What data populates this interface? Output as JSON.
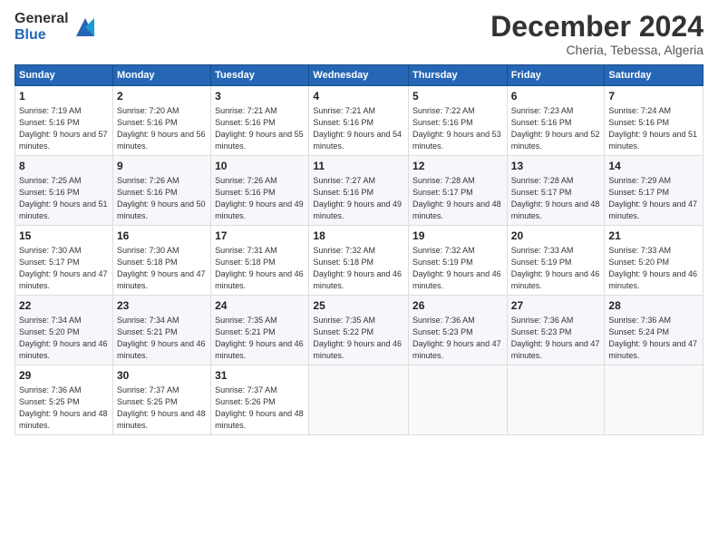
{
  "logo": {
    "general": "General",
    "blue": "Blue"
  },
  "header": {
    "month": "December 2024",
    "location": "Cheria, Tebessa, Algeria"
  },
  "weekdays": [
    "Sunday",
    "Monday",
    "Tuesday",
    "Wednesday",
    "Thursday",
    "Friday",
    "Saturday"
  ],
  "weeks": [
    [
      {
        "day": "1",
        "sunrise": "7:19 AM",
        "sunset": "5:16 PM",
        "daylight": "9 hours and 57 minutes."
      },
      {
        "day": "2",
        "sunrise": "7:20 AM",
        "sunset": "5:16 PM",
        "daylight": "9 hours and 56 minutes."
      },
      {
        "day": "3",
        "sunrise": "7:21 AM",
        "sunset": "5:16 PM",
        "daylight": "9 hours and 55 minutes."
      },
      {
        "day": "4",
        "sunrise": "7:21 AM",
        "sunset": "5:16 PM",
        "daylight": "9 hours and 54 minutes."
      },
      {
        "day": "5",
        "sunrise": "7:22 AM",
        "sunset": "5:16 PM",
        "daylight": "9 hours and 53 minutes."
      },
      {
        "day": "6",
        "sunrise": "7:23 AM",
        "sunset": "5:16 PM",
        "daylight": "9 hours and 52 minutes."
      },
      {
        "day": "7",
        "sunrise": "7:24 AM",
        "sunset": "5:16 PM",
        "daylight": "9 hours and 51 minutes."
      }
    ],
    [
      {
        "day": "8",
        "sunrise": "7:25 AM",
        "sunset": "5:16 PM",
        "daylight": "9 hours and 51 minutes."
      },
      {
        "day": "9",
        "sunrise": "7:26 AM",
        "sunset": "5:16 PM",
        "daylight": "9 hours and 50 minutes."
      },
      {
        "day": "10",
        "sunrise": "7:26 AM",
        "sunset": "5:16 PM",
        "daylight": "9 hours and 49 minutes."
      },
      {
        "day": "11",
        "sunrise": "7:27 AM",
        "sunset": "5:16 PM",
        "daylight": "9 hours and 49 minutes."
      },
      {
        "day": "12",
        "sunrise": "7:28 AM",
        "sunset": "5:17 PM",
        "daylight": "9 hours and 48 minutes."
      },
      {
        "day": "13",
        "sunrise": "7:28 AM",
        "sunset": "5:17 PM",
        "daylight": "9 hours and 48 minutes."
      },
      {
        "day": "14",
        "sunrise": "7:29 AM",
        "sunset": "5:17 PM",
        "daylight": "9 hours and 47 minutes."
      }
    ],
    [
      {
        "day": "15",
        "sunrise": "7:30 AM",
        "sunset": "5:17 PM",
        "daylight": "9 hours and 47 minutes."
      },
      {
        "day": "16",
        "sunrise": "7:30 AM",
        "sunset": "5:18 PM",
        "daylight": "9 hours and 47 minutes."
      },
      {
        "day": "17",
        "sunrise": "7:31 AM",
        "sunset": "5:18 PM",
        "daylight": "9 hours and 46 minutes."
      },
      {
        "day": "18",
        "sunrise": "7:32 AM",
        "sunset": "5:18 PM",
        "daylight": "9 hours and 46 minutes."
      },
      {
        "day": "19",
        "sunrise": "7:32 AM",
        "sunset": "5:19 PM",
        "daylight": "9 hours and 46 minutes."
      },
      {
        "day": "20",
        "sunrise": "7:33 AM",
        "sunset": "5:19 PM",
        "daylight": "9 hours and 46 minutes."
      },
      {
        "day": "21",
        "sunrise": "7:33 AM",
        "sunset": "5:20 PM",
        "daylight": "9 hours and 46 minutes."
      }
    ],
    [
      {
        "day": "22",
        "sunrise": "7:34 AM",
        "sunset": "5:20 PM",
        "daylight": "9 hours and 46 minutes."
      },
      {
        "day": "23",
        "sunrise": "7:34 AM",
        "sunset": "5:21 PM",
        "daylight": "9 hours and 46 minutes."
      },
      {
        "day": "24",
        "sunrise": "7:35 AM",
        "sunset": "5:21 PM",
        "daylight": "9 hours and 46 minutes."
      },
      {
        "day": "25",
        "sunrise": "7:35 AM",
        "sunset": "5:22 PM",
        "daylight": "9 hours and 46 minutes."
      },
      {
        "day": "26",
        "sunrise": "7:36 AM",
        "sunset": "5:23 PM",
        "daylight": "9 hours and 47 minutes."
      },
      {
        "day": "27",
        "sunrise": "7:36 AM",
        "sunset": "5:23 PM",
        "daylight": "9 hours and 47 minutes."
      },
      {
        "day": "28",
        "sunrise": "7:36 AM",
        "sunset": "5:24 PM",
        "daylight": "9 hours and 47 minutes."
      }
    ],
    [
      {
        "day": "29",
        "sunrise": "7:36 AM",
        "sunset": "5:25 PM",
        "daylight": "9 hours and 48 minutes."
      },
      {
        "day": "30",
        "sunrise": "7:37 AM",
        "sunset": "5:25 PM",
        "daylight": "9 hours and 48 minutes."
      },
      {
        "day": "31",
        "sunrise": "7:37 AM",
        "sunset": "5:26 PM",
        "daylight": "9 hours and 48 minutes."
      },
      null,
      null,
      null,
      null
    ]
  ],
  "labels": {
    "sunrise": "Sunrise:",
    "sunset": "Sunset:",
    "daylight": "Daylight:"
  }
}
